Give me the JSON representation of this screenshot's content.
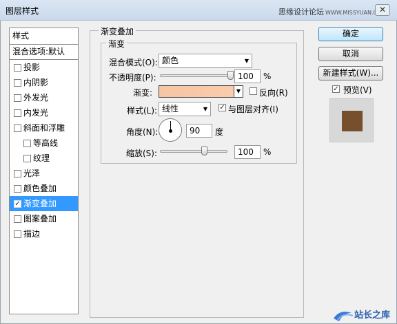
{
  "window": {
    "title": "图层样式",
    "watermark": "思缘设计论坛",
    "watermark_url": "WWW.MISSYUAN.COM",
    "close_glyph": "✕"
  },
  "styles_list": {
    "header": "样式",
    "blend_options": "混合选项:默认",
    "items": [
      {
        "label": "投影",
        "checked": false,
        "sub": false
      },
      {
        "label": "内阴影",
        "checked": false,
        "sub": false
      },
      {
        "label": "外发光",
        "checked": false,
        "sub": false
      },
      {
        "label": "内发光",
        "checked": false,
        "sub": false
      },
      {
        "label": "斜面和浮雕",
        "checked": false,
        "sub": false
      },
      {
        "label": "等高线",
        "checked": false,
        "sub": true
      },
      {
        "label": "纹理",
        "checked": false,
        "sub": true
      },
      {
        "label": "光泽",
        "checked": false,
        "sub": false
      },
      {
        "label": "颜色叠加",
        "checked": false,
        "sub": false
      },
      {
        "label": "渐变叠加",
        "checked": true,
        "sub": false,
        "selected": true
      },
      {
        "label": "图案叠加",
        "checked": false,
        "sub": false
      },
      {
        "label": "描边",
        "checked": false,
        "sub": false
      }
    ]
  },
  "gradient_overlay": {
    "section_title": "渐变叠加",
    "group_title": "渐变",
    "blend_mode_label": "混合模式(O):",
    "blend_mode_value": "颜色",
    "opacity_label": "不透明度(P):",
    "opacity_value": "100",
    "opacity_percent": 1.0,
    "percent_sign": "%",
    "gradient_label": "渐变:",
    "gradient_colors": [
      "#f6c5a4",
      "#f8ccac"
    ],
    "reverse_label": "反向(R)",
    "reverse_checked": false,
    "style_label": "样式(L):",
    "style_value": "线性",
    "align_label": "与图层对齐(I)",
    "align_checked": true,
    "angle_label": "角度(N):",
    "angle_value": "90",
    "angle_unit": "度",
    "scale_label": "缩放(S):",
    "scale_value": "100",
    "scale_fraction": 0.5
  },
  "buttons": {
    "ok": "确定",
    "cancel": "取消",
    "new_style": "新建样式(W)...",
    "preview_label": "预览(V)",
    "preview_checked": true
  },
  "preview_color": "#76502d",
  "logo_text": "站长之库",
  "accent_color": "#3399ff"
}
